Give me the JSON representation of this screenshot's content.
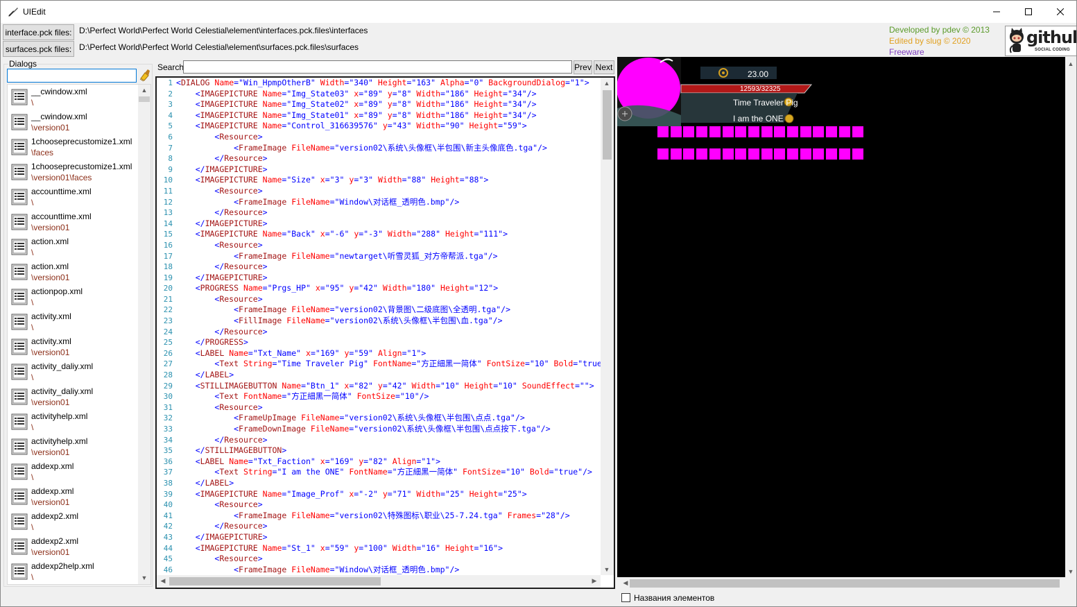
{
  "window": {
    "title": "UIEdit"
  },
  "paths": {
    "interface_button": "interface.pck files:",
    "interface_path": "D:\\Perfect World\\Perfect World Celestial\\element\\interfaces.pck.files\\interfaces",
    "surfaces_button": "surfaces.pck files:",
    "surfaces_path": "D:\\Perfect World\\Perfect World Celestial\\element\\surfaces.pck.files\\surfaces"
  },
  "credits": {
    "developed": "Developed by pdev © 2013",
    "edited": "Edited by slug © 2020",
    "freeware": "Freeware",
    "github_word": "github",
    "github_sub": "SOCIAL CODING"
  },
  "dialogs": {
    "label": "Dialogs",
    "filter_value": "",
    "files": [
      {
        "name": "__cwindow.xml",
        "dir": "\\"
      },
      {
        "name": "__cwindow.xml",
        "dir": "\\version01"
      },
      {
        "name": "1chooseprecustomize1.xml",
        "dir": "\\faces"
      },
      {
        "name": "1chooseprecustomize1.xml",
        "dir": "\\version01\\faces"
      },
      {
        "name": "accounttime.xml",
        "dir": "\\"
      },
      {
        "name": "accounttime.xml",
        "dir": "\\version01"
      },
      {
        "name": "action.xml",
        "dir": "\\"
      },
      {
        "name": "action.xml",
        "dir": "\\version01"
      },
      {
        "name": "actionpop.xml",
        "dir": "\\"
      },
      {
        "name": "activity.xml",
        "dir": "\\"
      },
      {
        "name": "activity.xml",
        "dir": "\\version01"
      },
      {
        "name": "activity_daliy.xml",
        "dir": "\\"
      },
      {
        "name": "activity_daliy.xml",
        "dir": "\\version01"
      },
      {
        "name": "activityhelp.xml",
        "dir": "\\"
      },
      {
        "name": "activityhelp.xml",
        "dir": "\\version01"
      },
      {
        "name": "addexp.xml",
        "dir": "\\"
      },
      {
        "name": "addexp.xml",
        "dir": "\\version01"
      },
      {
        "name": "addexp2.xml",
        "dir": "\\"
      },
      {
        "name": "addexp2.xml",
        "dir": "\\version01"
      },
      {
        "name": "addexp2help.xml",
        "dir": "\\"
      }
    ]
  },
  "search": {
    "label": "Search",
    "value": "",
    "prev": "Prev",
    "next": "Next"
  },
  "editor": {
    "lines": [
      "<DIALOG Name=\"Win_HpmpOtherB\" Width=\"340\" Height=\"163\" Alpha=\"0\" BackgroundDialog=\"1\">",
      "    <IMAGEPICTURE Name=\"Img_State03\" x=\"89\" y=\"8\" Width=\"186\" Height=\"34\"/>",
      "    <IMAGEPICTURE Name=\"Img_State02\" x=\"89\" y=\"8\" Width=\"186\" Height=\"34\"/>",
      "    <IMAGEPICTURE Name=\"Img_State01\" x=\"89\" y=\"8\" Width=\"186\" Height=\"34\"/>",
      "    <IMAGEPICTURE Name=\"Control_316639576\" y=\"43\" Width=\"90\" Height=\"59\">",
      "        <Resource>",
      "            <FrameImage FileName=\"version02\\系统\\头像框\\半包围\\新主头像底色.tga\"/>",
      "        </Resource>",
      "    </IMAGEPICTURE>",
      "    <IMAGEPICTURE Name=\"Size\" x=\"3\" y=\"3\" Width=\"88\" Height=\"88\">",
      "        <Resource>",
      "            <FrameImage FileName=\"Window\\对话框_透明色.bmp\"/>",
      "        </Resource>",
      "    </IMAGEPICTURE>",
      "    <IMAGEPICTURE Name=\"Back\" x=\"-6\" y=\"-3\" Width=\"288\" Height=\"111\">",
      "        <Resource>",
      "            <FrameImage FileName=\"newtarget\\听雪灵狐_对方帝帮派.tga\"/>",
      "        </Resource>",
      "    </IMAGEPICTURE>",
      "    <PROGRESS Name=\"Prgs_HP\" x=\"95\" y=\"42\" Width=\"180\" Height=\"12\">",
      "        <Resource>",
      "            <FrameImage FileName=\"version02\\背景图\\二级底图\\全透明.tga\"/>",
      "            <FillImage FileName=\"version02\\系统\\头像框\\半包围\\血.tga\"/>",
      "        </Resource>",
      "    </PROGRESS>",
      "    <LABEL Name=\"Txt_Name\" x=\"169\" y=\"59\" Align=\"1\">",
      "        <Text String=\"Time Traveler Pig\" FontName=\"方正細黑一简体\" FontSize=\"10\" Bold=\"true\"/>",
      "    </LABEL>",
      "    <STILLIMAGEBUTTON Name=\"Btn_1\" x=\"82\" y=\"42\" Width=\"10\" Height=\"10\" SoundEffect=\"\">",
      "        <Text FontName=\"方正細黑一简体\" FontSize=\"10\"/>",
      "        <Resource>",
      "            <FrameUpImage FileName=\"version02\\系统\\头像框\\半包围\\点点.tga\"/>",
      "            <FrameDownImage FileName=\"version02\\系统\\头像框\\半包围\\点点按下.tga\"/>",
      "        </Resource>",
      "    </STILLIMAGEBUTTON>",
      "    <LABEL Name=\"Txt_Faction\" x=\"169\" y=\"82\" Align=\"1\">",
      "        <Text String=\"I am the ONE\" FontName=\"方正細黑一简体\" FontSize=\"10\" Bold=\"true\"/>",
      "    </LABEL>",
      "    <IMAGEPICTURE Name=\"Image_Prof\" x=\"-2\" y=\"71\" Width=\"25\" Height=\"25\">",
      "        <Resource>",
      "            <FrameImage FileName=\"version02\\特殊图标\\职业\\25-7.24.tga\" Frames=\"28\"/>",
      "        </Resource>",
      "    </IMAGEPICTURE>",
      "    <IMAGEPICTURE Name=\"St_1\" x=\"59\" y=\"100\" Width=\"16\" Height=\"16\">",
      "        <Resource>",
      "            <FrameImage FileName=\"Window\\对话框_透明色.bmp\"/>"
    ]
  },
  "preview": {
    "level_value": "23.00",
    "hp_value": "12593/32325",
    "name_text": "Time Traveler Pig",
    "faction_text": "I am the ONE",
    "icon_rows": 2,
    "icons_per_row": 16,
    "magenta": "#ff00ff"
  },
  "footer": {
    "names_checkbox_label": "Названия элементов",
    "names_checked": false
  }
}
